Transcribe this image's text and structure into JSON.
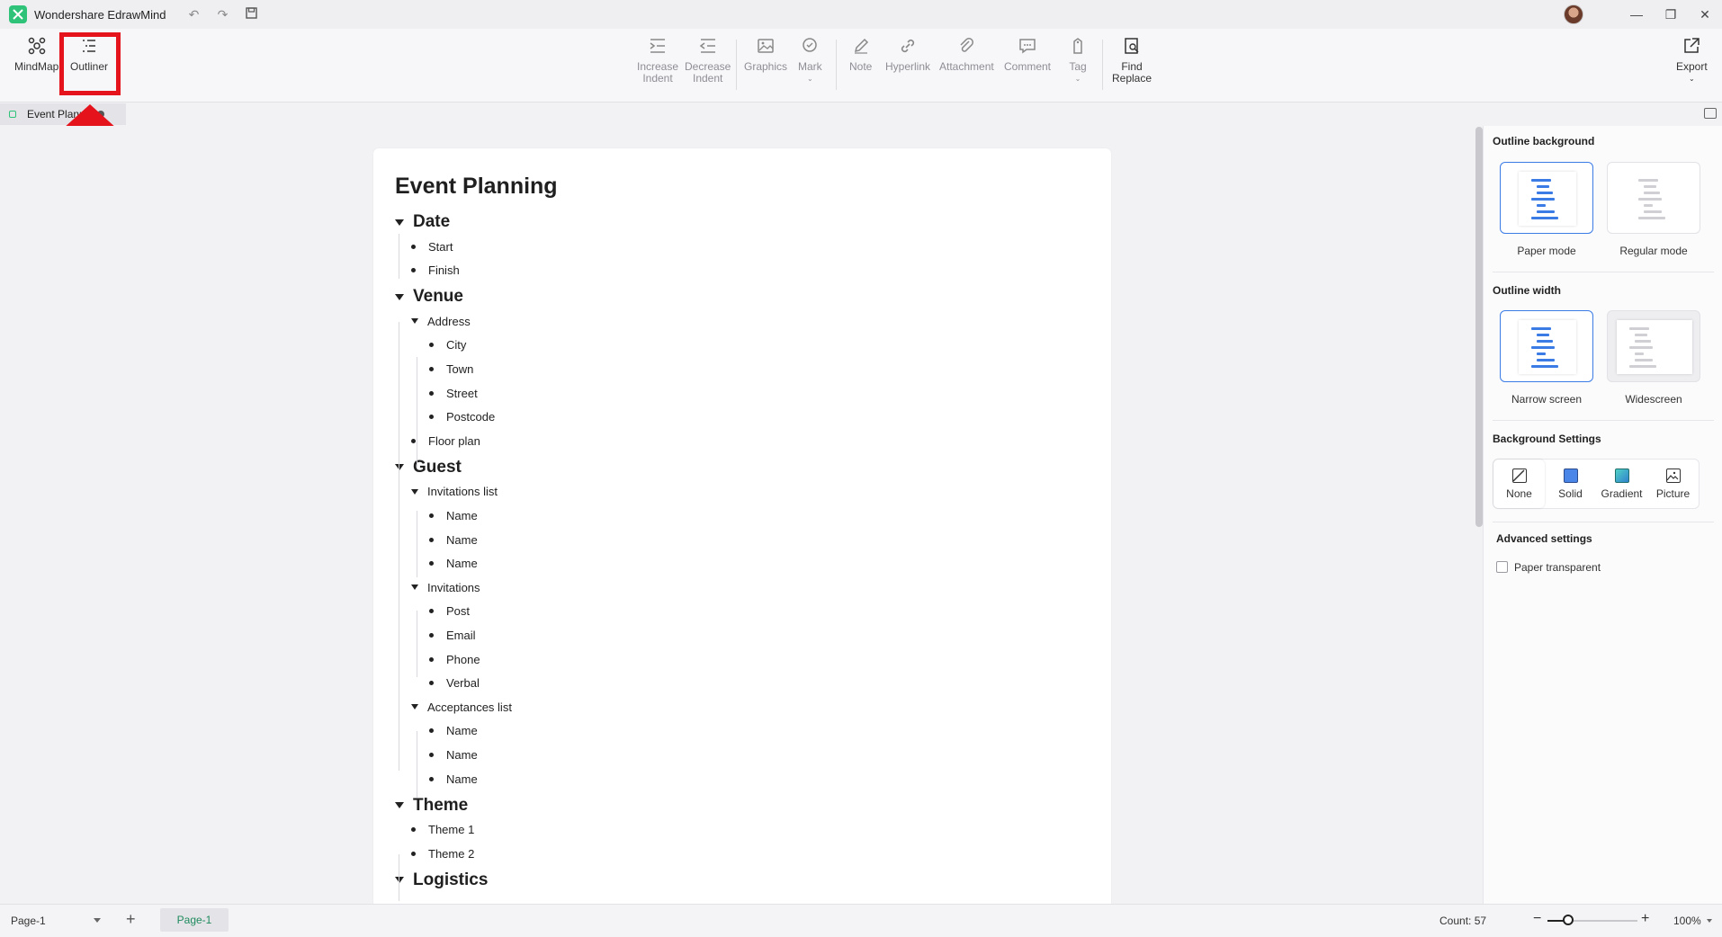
{
  "titlebar": {
    "app_title": "Wondershare EdrawMind",
    "quick_actions": [
      "undo-icon",
      "redo-icon",
      "save-icon"
    ]
  },
  "ribbon": {
    "mindmap_label": "MindMap",
    "outliner_label": "Outliner",
    "increase_indent": [
      "Increase",
      "Indent"
    ],
    "decrease_indent": [
      "Decrease",
      "Indent"
    ],
    "graphics": "Graphics",
    "mark": "Mark",
    "note": "Note",
    "hyperlink": "Hyperlink",
    "attachment": "Attachment",
    "comment": "Comment",
    "tag": "Tag",
    "find_replace": [
      "Find",
      "Replace"
    ],
    "export": "Export"
  },
  "doc_tab": {
    "label": "Event Planning"
  },
  "outline": {
    "title": "Event Planning",
    "rows": [
      {
        "level": 1,
        "text": "Date",
        "expanded": true
      },
      {
        "level": 2,
        "text": "Start"
      },
      {
        "level": 2,
        "text": "Finish"
      },
      {
        "level": 1,
        "text": "Venue",
        "expanded": true
      },
      {
        "level": 2,
        "text": "Address",
        "expanded": true
      },
      {
        "level": 3,
        "text": "City"
      },
      {
        "level": 3,
        "text": "Town"
      },
      {
        "level": 3,
        "text": "Street"
      },
      {
        "level": 3,
        "text": "Postcode"
      },
      {
        "level": 2,
        "text": "Floor plan"
      },
      {
        "level": 1,
        "text": "Guest",
        "expanded": true
      },
      {
        "level": 2,
        "text": "Invitations list",
        "expanded": true
      },
      {
        "level": 3,
        "text": "Name"
      },
      {
        "level": 3,
        "text": "Name"
      },
      {
        "level": 3,
        "text": "Name"
      },
      {
        "level": 2,
        "text": "Invitations",
        "expanded": true
      },
      {
        "level": 3,
        "text": "Post"
      },
      {
        "level": 3,
        "text": "Email"
      },
      {
        "level": 3,
        "text": "Phone"
      },
      {
        "level": 3,
        "text": "Verbal"
      },
      {
        "level": 2,
        "text": "Acceptances list",
        "expanded": true
      },
      {
        "level": 3,
        "text": "Name"
      },
      {
        "level": 3,
        "text": "Name"
      },
      {
        "level": 3,
        "text": "Name"
      },
      {
        "level": 1,
        "text": "Theme",
        "expanded": true
      },
      {
        "level": 2,
        "text": "Theme 1"
      },
      {
        "level": 2,
        "text": "Theme 2"
      },
      {
        "level": 1,
        "text": "Logistics",
        "expanded": true
      }
    ]
  },
  "panel": {
    "outline_background": "Outline background",
    "paper_mode": "Paper mode",
    "regular_mode": "Regular mode",
    "outline_width": "Outline width",
    "narrow_screen": "Narrow screen",
    "widescreen": "Widescreen",
    "background_settings": "Background Settings",
    "bg_options": [
      "None",
      "Solid",
      "Gradient",
      "Picture"
    ],
    "advanced_settings": "Advanced settings",
    "paper_transparent": "Paper transparent",
    "accent": "#3b7be6"
  },
  "status": {
    "page_select": "Page-1",
    "page_tab": "Page-1",
    "count": "Count: 57",
    "zoom": "100%"
  }
}
